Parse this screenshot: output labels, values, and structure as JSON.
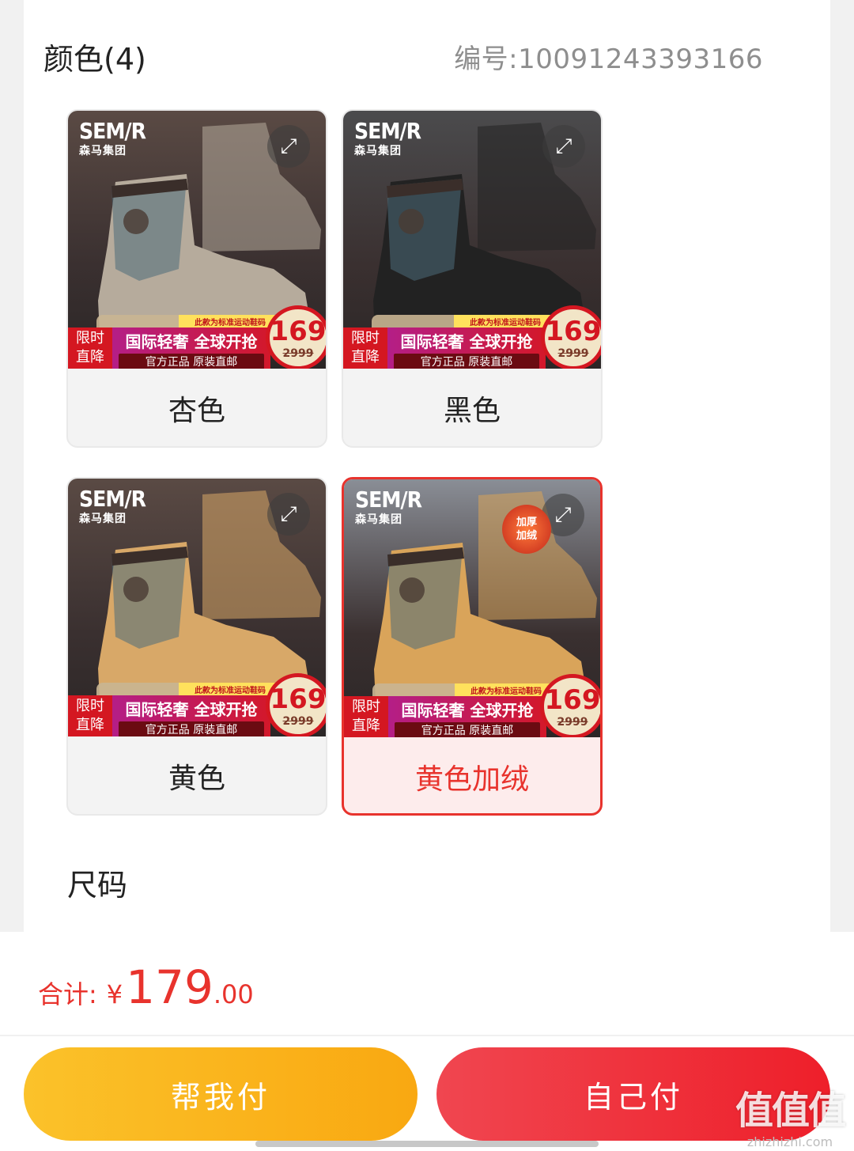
{
  "colors": {
    "accent": "#e8332d",
    "help_button": "#f9b21c",
    "self_button": "#ef2e38"
  },
  "section": {
    "title": "颜色(4)",
    "sku_code": "编号:10091243393166"
  },
  "variants": [
    {
      "label": "杏色",
      "selected": false,
      "boot_color": "#b6ab9c",
      "bg": "#5a4a44"
    },
    {
      "label": "黑色",
      "selected": false,
      "boot_color": "#222222",
      "bg": "#4b4b4d"
    },
    {
      "label": "黄色",
      "selected": false,
      "boot_color": "#d8a868",
      "bg": "#5a4a44"
    },
    {
      "label": "黄色加绒",
      "selected": true,
      "boot_color": "#d9a45a",
      "bg": "#8a8e96"
    }
  ],
  "promo": {
    "brand_main": "SEM/R",
    "brand_sub": "森马集团",
    "note": "此款为标准运动鞋码",
    "left_line1": "限时",
    "left_line2": "直降",
    "mid_line1": "国际轻奢 全球开抢",
    "mid_line2": "官方正品 原装直邮",
    "price": "169",
    "orig_price": "2999",
    "fleece_badge_line1": "加厚",
    "fleece_badge_line2": "加绒"
  },
  "size_section": {
    "title": "尺码"
  },
  "footer": {
    "total_label": "合计:",
    "currency": "¥",
    "total_int": "179",
    "total_dec": ".00",
    "help_pay": "帮我付",
    "self_pay": "自己付"
  },
  "watermark": {
    "logo": "值值值",
    "domain": "zhizhizhi.com"
  }
}
